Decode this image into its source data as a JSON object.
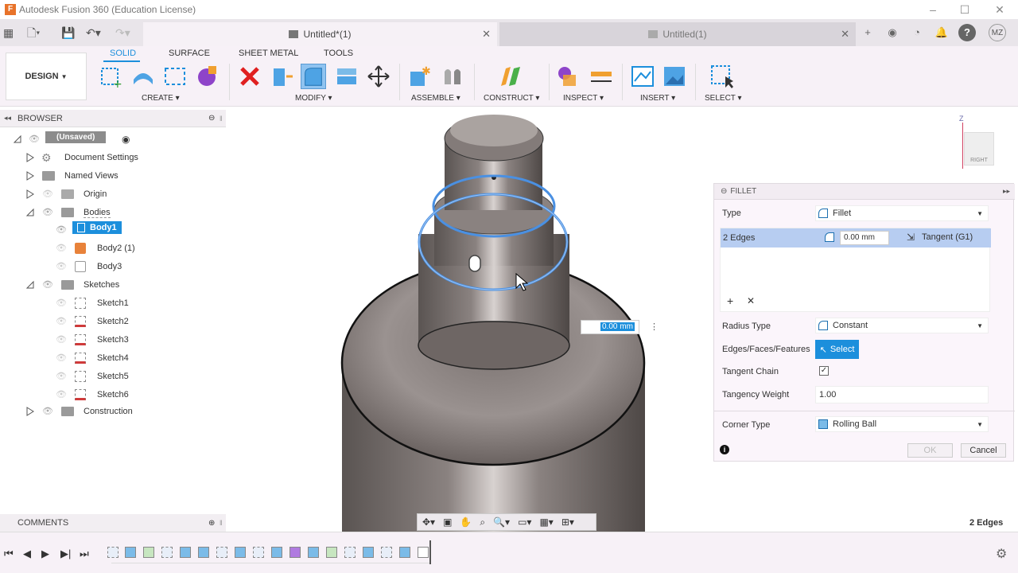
{
  "app": {
    "title": "Autodesk Fusion 360 (Education License)",
    "icon_letter": "F"
  },
  "tabs": [
    {
      "label": "Untitled*(1)",
      "active": true
    },
    {
      "label": "Untitled(1)",
      "active": false
    }
  ],
  "user_initials": "MZ",
  "toolbar": {
    "design_label": "DESIGN",
    "tabs": [
      "SOLID",
      "SURFACE",
      "SHEET METAL",
      "TOOLS"
    ],
    "groups": [
      "CREATE",
      "MODIFY",
      "ASSEMBLE",
      "CONSTRUCT",
      "INSPECT",
      "INSERT",
      "SELECT"
    ]
  },
  "browser": {
    "title": "BROWSER",
    "root": "(Unsaved)",
    "items": {
      "document_settings": "Document Settings",
      "named_views": "Named Views",
      "origin": "Origin",
      "bodies": "Bodies",
      "body1": "Body1",
      "body2": "Body2 (1)",
      "body3": "Body3",
      "sketches": "Sketches",
      "sketch1": "Sketch1",
      "sketch2": "Sketch2",
      "sketch3": "Sketch3",
      "sketch4": "Sketch4",
      "sketch5": "Sketch5",
      "sketch6": "Sketch6",
      "construction": "Construction"
    }
  },
  "comments_label": "COMMENTS",
  "viewcube": {
    "face": "RIGHT",
    "axis_z": "Z"
  },
  "viewport": {
    "radius_input": "0.00 mm"
  },
  "fillet": {
    "title": "FILLET",
    "type_label": "Type",
    "type_value": "Fillet",
    "edges_label": "2 Edges",
    "edges_radius": "0.00 mm",
    "edges_continuity": "Tangent (G1)",
    "radius_type_label": "Radius Type",
    "radius_type_value": "Constant",
    "efl_label": "Edges/Faces/Features",
    "select_label": "Select",
    "tangent_chain_label": "Tangent Chain",
    "tangent_chain_checked": true,
    "tangency_weight_label": "Tangency Weight",
    "tangency_weight_value": "1.00",
    "corner_type_label": "Corner Type",
    "corner_type_value": "Rolling Ball",
    "ok_label": "OK",
    "cancel_label": "Cancel"
  },
  "status": {
    "selection": "2 Edges"
  },
  "colors": {
    "accent": "#1c8fdc",
    "panel_bg": "#f7f1f7",
    "selection_row": "#b7cdf1"
  }
}
